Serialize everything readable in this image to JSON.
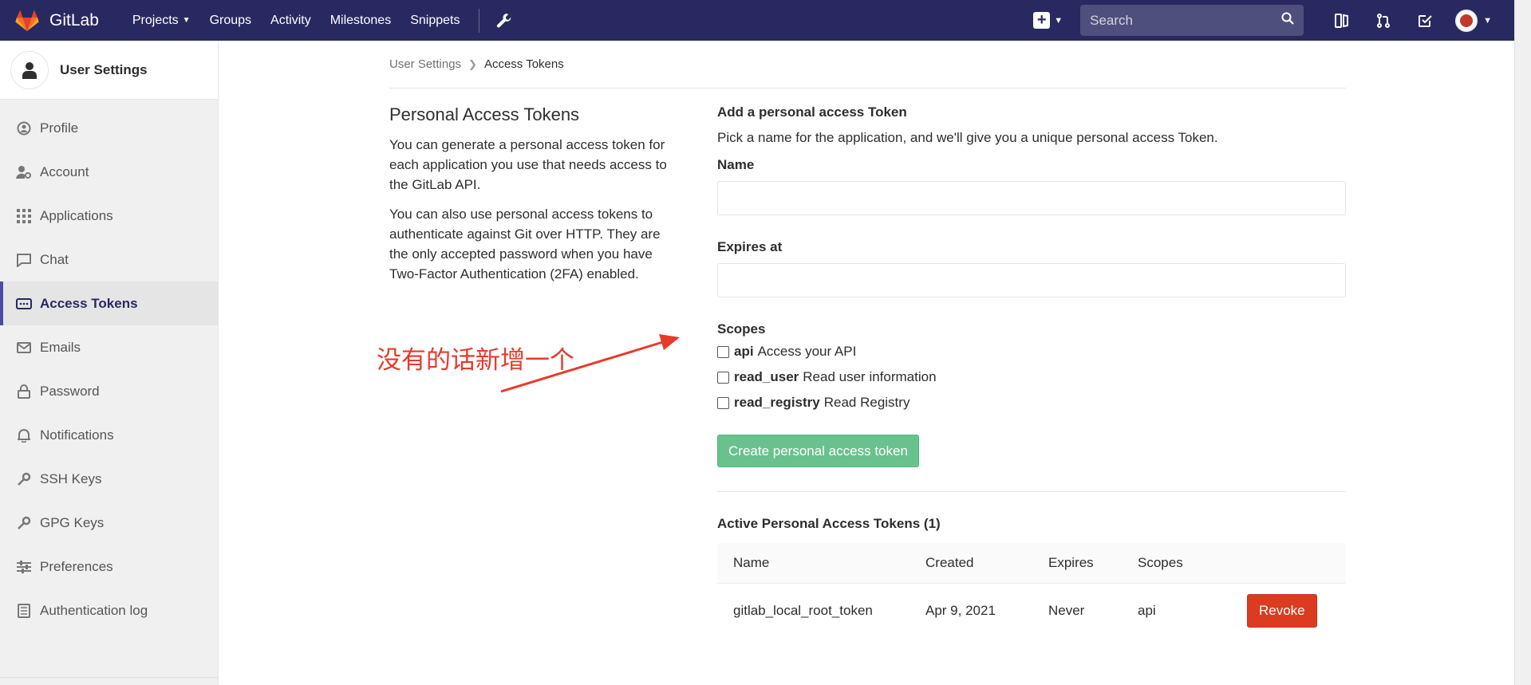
{
  "nav": {
    "brand": "GitLab",
    "links": [
      {
        "label": "Projects",
        "has_caret": true
      },
      {
        "label": "Groups"
      },
      {
        "label": "Activity"
      },
      {
        "label": "Milestones"
      },
      {
        "label": "Snippets"
      }
    ],
    "search_placeholder": "Search",
    "colors": {
      "navbar": "#292961",
      "accent": "#4b4ba3"
    }
  },
  "sidebar": {
    "title": "User Settings",
    "items": [
      {
        "label": "Profile",
        "icon": "profile-icon"
      },
      {
        "label": "Account",
        "icon": "account-icon"
      },
      {
        "label": "Applications",
        "icon": "applications-icon"
      },
      {
        "label": "Chat",
        "icon": "chat-icon"
      },
      {
        "label": "Access Tokens",
        "icon": "access-tokens-icon",
        "active": true
      },
      {
        "label": "Emails",
        "icon": "emails-icon"
      },
      {
        "label": "Password",
        "icon": "lock-icon"
      },
      {
        "label": "Notifications",
        "icon": "bell-icon"
      },
      {
        "label": "SSH Keys",
        "icon": "key-icon"
      },
      {
        "label": "GPG Keys",
        "icon": "key-icon"
      },
      {
        "label": "Preferences",
        "icon": "sliders-icon"
      },
      {
        "label": "Authentication log",
        "icon": "log-icon"
      }
    ]
  },
  "breadcrumb": {
    "parent": "User Settings",
    "current": "Access Tokens"
  },
  "left": {
    "title": "Personal Access Tokens",
    "p1": "You can generate a personal access token for each application you use that needs access to the GitLab API.",
    "p2": "You can also use personal access tokens to authenticate against Git over HTTP. They are the only accepted password when you have Two-Factor Authentication (2FA) enabled."
  },
  "annotation": "没有的话新增一个",
  "form": {
    "heading": "Add a personal access Token",
    "description": "Pick a name for the application, and we'll give you a unique personal access Token.",
    "name_label": "Name",
    "name_value": "",
    "expires_label": "Expires at",
    "expires_value": "",
    "scopes_label": "Scopes",
    "scopes": [
      {
        "key": "api",
        "desc": "Access your API",
        "checked": false
      },
      {
        "key": "read_user",
        "desc": "Read user information",
        "checked": false
      },
      {
        "key": "read_registry",
        "desc": "Read Registry",
        "checked": false
      }
    ],
    "submit_label": "Create personal access token"
  },
  "active_tokens": {
    "heading": "Active Personal Access Tokens (1)",
    "columns": [
      "Name",
      "Created",
      "Expires",
      "Scopes"
    ],
    "rows": [
      {
        "name": "gitlab_local_root_token",
        "created": "Apr 9, 2021",
        "expires": "Never",
        "scopes": "api",
        "action": "Revoke"
      }
    ]
  }
}
